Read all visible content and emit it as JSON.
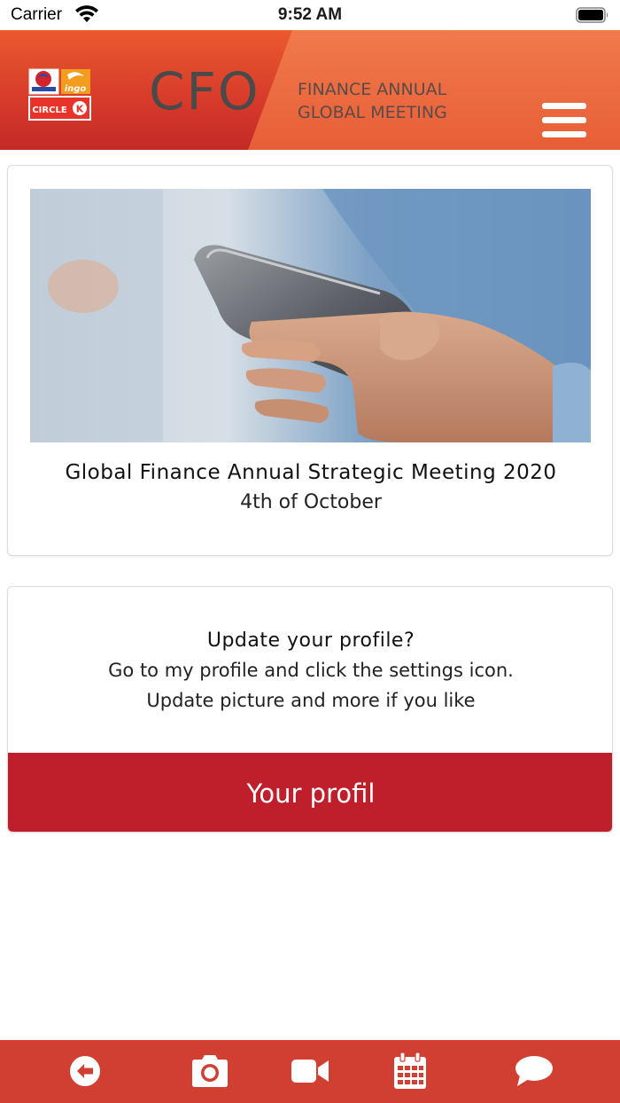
{
  "status_bar": {
    "carrier": "Carrier",
    "time": "9:52 AM",
    "wifi_icon": "wifi-icon",
    "battery_icon": "battery-icon"
  },
  "header": {
    "logo_icon": "brand-logo",
    "title": "CFO",
    "subtitle_line1": "FINANCE ANNUAL",
    "subtitle_line2": "GLOBAL MEETING",
    "menu_icon": "hamburger-menu-icon"
  },
  "event": {
    "image": "hand-holding-smartphone-photo",
    "title": "Global Finance Annual Strategic Meeting 2020",
    "date": "4th of October"
  },
  "profile": {
    "heading": "Update your profile?",
    "line1": "Go to my profile and click the settings icon.",
    "line2": "Update picture and more if you like",
    "button_label": "Your profil"
  },
  "bottom_nav": {
    "items": [
      {
        "icon": "back-arrow-icon"
      },
      {
        "icon": "camera-icon"
      },
      {
        "icon": "video-camera-icon"
      },
      {
        "icon": "calendar-icon"
      },
      {
        "icon": "chat-bubble-icon"
      }
    ]
  },
  "colors": {
    "header_gradient_start": "#ea5a2f",
    "header_gradient_end": "#c42a26",
    "accent_button": "#be1f2b",
    "bottom_nav": "#d13f33",
    "title_gray": "#4a4a4a"
  }
}
